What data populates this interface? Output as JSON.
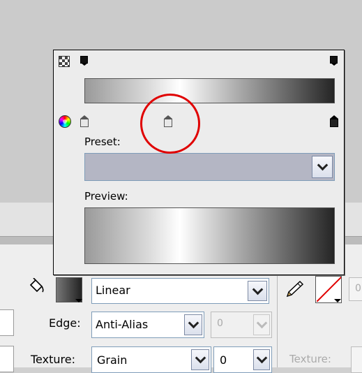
{
  "gradient_popup": {
    "preset_label": "Preset:",
    "preset_value": "",
    "preview_label": "Preview:",
    "icons": {
      "alpha_checker": "checker-icon",
      "color_wheel": "color-wheel-icon"
    },
    "gradient_stops": {
      "top": [
        "left",
        "right"
      ],
      "bottom": [
        "left",
        "middle-selected",
        "right"
      ]
    },
    "highlight_color": "#e00000"
  },
  "fill_panel": {
    "fill_type": "Linear",
    "edge_label": "Edge:",
    "edge_value": "Anti-Alias",
    "edge_amount": "0",
    "texture_label": "Texture:",
    "texture_value": "Grain",
    "texture_amount": "0",
    "texture_label_disabled": "Texture:",
    "stroke_amount": "0"
  }
}
